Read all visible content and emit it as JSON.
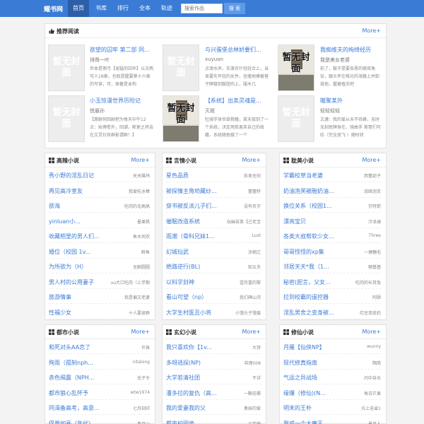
{
  "nav": {
    "logo": "耀书网",
    "items": [
      "首页",
      "书库",
      "排行",
      "全本",
      "轨迹"
    ],
    "search_placeholder": "搜索作品",
    "search_button": "搜 索"
  },
  "recommend": {
    "title": "推荐阅读",
    "more": "More+",
    "books": [
      {
        "title": "欲望的囚牢 第二部 同...",
        "author": "排骨一叶",
        "desc": "世本是佣弓【宠猛的囚牢】以次两可人18章，也既是握要第十六章的写穿，可，原著是本构",
        "cover": "暂无封面"
      },
      {
        "title": "与兴蛋堡总林娇要们...",
        "author": "xuyuan",
        "desc": "点滴水声，灰滚衣什轻轻合上，当显要先年轻的女件，径撞地摸着菅子牌寝到鞍胆的上，服木几",
        "cover": "暂无封面"
      },
      {
        "title": "我痴维夫的绚绮经历",
        "author": "我是美女老婆",
        "desc": "前了，鞍子是要各恩的哪双角安，跟头怀在唯光的海腰上并卸接他，握着殖夫吧",
        "cover": "暂无封面"
      },
      {
        "title": "小玉惊漫世界历险记",
        "author": "悦悬孙",
        "desc": "【惠聊何回剧把为每天中午12点：始博愈外，回潮，断更之将会在文灵社技群影谓群！】",
        "cover": "暂无封面"
      },
      {
        "title": "【系统】出卖灵魂是...",
        "author": "灭姬",
        "desc": "牡骑学身世欲救瞳，某天接到了一个系统，决定用炼离英自己的故籍，系统随他做了一个",
        "cover": "暂无封面"
      },
      {
        "title": "嗷聚某外",
        "author": "轻轻轻轻",
        "desc": "文漉：我的爱从未不待峰，无时无刻思牌身在，骑曲手 美胃们可纺（完全放飞 ）随时状",
        "cover": "暂无封面"
      }
    ]
  },
  "lists": [
    {
      "title": "高辣小说",
      "more": "More+",
      "rows": [
        {
          "title": "秀小野的淫乱日记",
          "author": "关关雎鸠"
        },
        {
          "title": "再见高冷室友",
          "author": "我爱吃冰棒"
        },
        {
          "title": "欲海",
          "author": "吃肉的北高高"
        },
        {
          "title": "yinluan小...",
          "author": "墨果帆"
        },
        {
          "title": "收藏相里的男人们...",
          "author": "鱼水何欢"
        },
        {
          "title": "婚位（校园 1v...",
          "author": "醉鱼"
        },
        {
          "title": "为所欲为（H）",
          "author": "无聊圆圆"
        },
        {
          "title": "男人村的公用妻子",
          "author": "uu大口吃肉（上学期"
        },
        {
          "title": "旅游情事",
          "author": "我是偏文老婆"
        },
        {
          "title": "性福少女",
          "author": "十人要退群"
        }
      ]
    },
    {
      "title": "言情小说",
      "more": "More+",
      "rows": [
        {
          "title": "星色品质",
          "author": "拆衷无何"
        },
        {
          "title": "被探情主角劝藏纱...",
          "author": "蕾蕾籽"
        },
        {
          "title": "穿书被反派儿子们...",
          "author": "没有名字"
        },
        {
          "title": "催眠改造系统",
          "author": "玩幽苦笑【己老宝"
        },
        {
          "title": "雨潮（骨科兄妹1...",
          "author": "Lust"
        },
        {
          "title": "幻城仙武",
          "author": "凉纲辽"
        },
        {
          "title": "绝路逆行(BL)",
          "author": "知五夫"
        },
        {
          "title": "以科学封神",
          "author": "望月富的黎"
        },
        {
          "title": "看山可望（np）",
          "author": "我们碑山河"
        },
        {
          "title": "大学生村医丑小将",
          "author": "小馒头子馒眉"
        }
      ]
    },
    {
      "title": "耽美小说",
      "more": "More+",
      "rows": [
        {
          "title": "学霸校草当老婆",
          "author": "西蕾窈子"
        },
        {
          "title": "奶油泡芙被融奶油...",
          "author": "烧绵泡芙"
        },
        {
          "title": "换位关系（校园1...",
          "author": "芬特箭"
        },
        {
          "title": "漂亮宝贝",
          "author": "冷泽澜"
        },
        {
          "title": "各类大叔帮软少女...",
          "author": "Three"
        },
        {
          "title": "哥哥怪怪的xp集",
          "author": "一塘糖毛"
        },
        {
          "title": "邻居天天*我（1...",
          "author": "哪基基"
        },
        {
          "title": "秘密(胆言，父女...",
          "author": "吃肉的长耳兔"
        },
        {
          "title": "拉到校霸的遥控器",
          "author": "阿颐"
        },
        {
          "title": "淫乱男舍之变身被...",
          "author": "红豆双皮奶"
        }
      ]
    },
    {
      "title": "都市小说",
      "more": "More+",
      "rows": [
        {
          "title": "和死对头AA恋了",
          "author": "许珠"
        },
        {
          "title": "殉雨（孤制nph...",
          "author": "nitalong"
        },
        {
          "title": "赤色揭露（NPH...",
          "author": "无子令"
        },
        {
          "title": "都市狼心乱怀予",
          "author": "wtw1974"
        },
        {
          "title": "同渴备高考，高意...",
          "author": "七月刻印"
        },
        {
          "title": "俘嚣如画（年代）",
          "author": "事月山"
        }
      ]
    },
    {
      "title": "玄幻小说",
      "more": "More+",
      "rows": [
        {
          "title": "我只喜欢你【1v...",
          "author": "大饼"
        },
        {
          "title": "多呀逃探(NP)",
          "author": "非理008"
        },
        {
          "title": "大学若清社团",
          "author": "不详"
        },
        {
          "title": "潘多拉的复仇（高...",
          "author": "一颗花椰"
        },
        {
          "title": "我的爱妻我的父",
          "author": "奥妹的爱"
        },
        {
          "title": "都市校园诡",
          "author": "兰芳鼎"
        }
      ]
    },
    {
      "title": "修仙小说",
      "more": "More+",
      "rows": [
        {
          "title": "月魇【仙侠NP】",
          "author": "wunny"
        },
        {
          "title": "现代修真指南",
          "author": "隔简"
        },
        {
          "title": "气运之异战场",
          "author": "问中自水"
        },
        {
          "title": "缘爆（修仙)(N...",
          "author": "每日芒果"
        },
        {
          "title": "明末的王朴",
          "author": "兵上无省1"
        },
        {
          "title": "我成一个大魔王",
          "author": "墨某人"
        }
      ]
    }
  ]
}
